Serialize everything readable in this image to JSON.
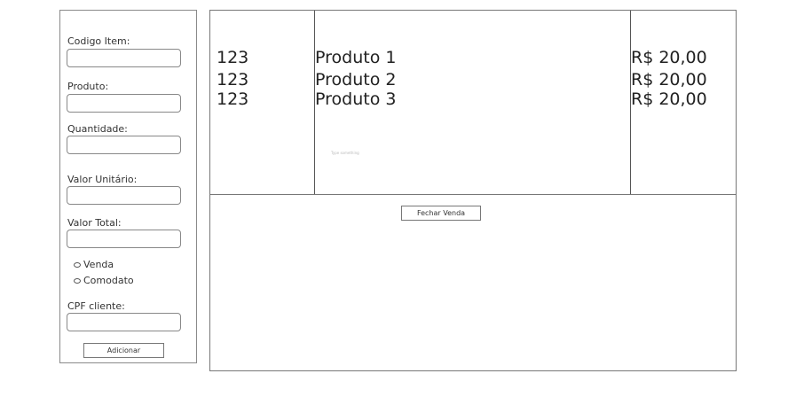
{
  "form": {
    "codigo_label": "Codigo Item:",
    "produto_label": "Produto:",
    "quantidade_label": "Quantidade:",
    "valor_unitario_label": "Valor Unitário:",
    "valor_total_label": "Valor Total:",
    "radio_venda": "Venda",
    "radio_comodato": "Comodato",
    "cpf_label": "CPF cliente:",
    "add_button": "Adicionar"
  },
  "items": [
    {
      "code": "123",
      "name": "Produto 1",
      "price": "R$ 20,00"
    },
    {
      "code": "123",
      "name": "Produto 2",
      "price": "R$ 20,00"
    },
    {
      "code": "123",
      "name": "Produto 3",
      "price": "R$ 20,00"
    }
  ],
  "tiny_note": "Type something",
  "close_button": "Fechar Venda"
}
